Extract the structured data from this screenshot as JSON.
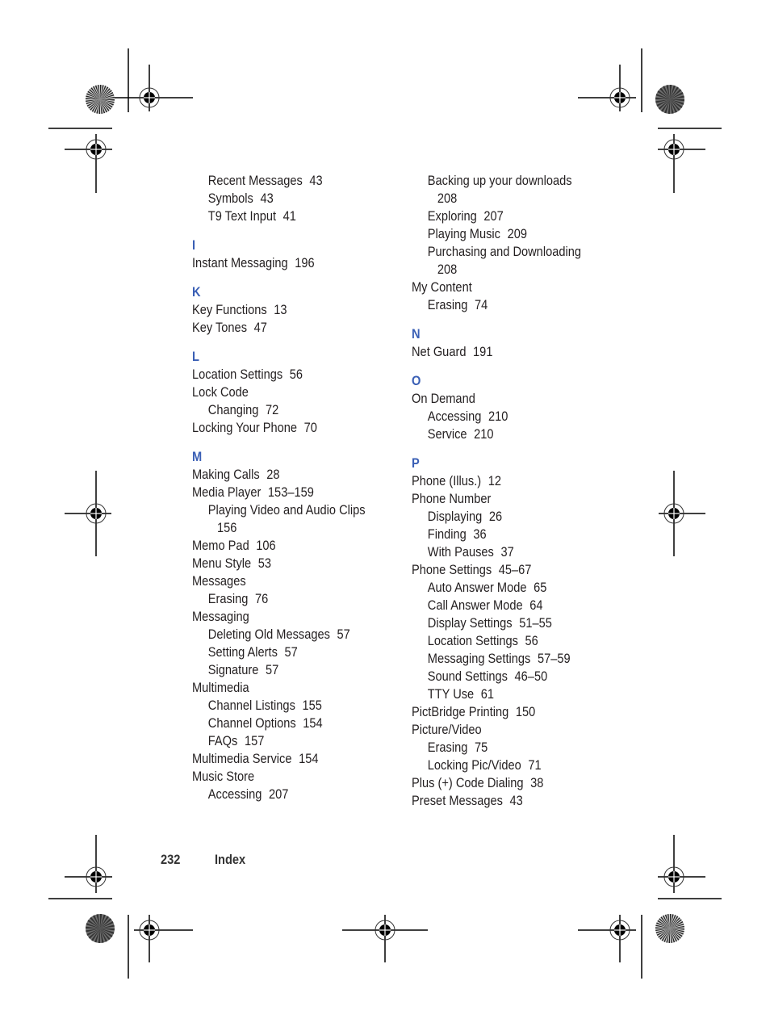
{
  "left_column": [
    {
      "type": "sub",
      "text": "Recent Messages",
      "page": "43"
    },
    {
      "type": "sub",
      "text": "Symbols",
      "page": "43"
    },
    {
      "type": "sub",
      "text": "T9 Text Input",
      "page": "41"
    },
    {
      "type": "letter",
      "text": "I"
    },
    {
      "type": "main",
      "text": "Instant Messaging",
      "page": "196"
    },
    {
      "type": "letter",
      "text": "K"
    },
    {
      "type": "main",
      "text": "Key Functions",
      "page": "13"
    },
    {
      "type": "main",
      "text": "Key Tones",
      "page": "47"
    },
    {
      "type": "letter",
      "text": "L"
    },
    {
      "type": "main",
      "text": "Location Settings",
      "page": "56"
    },
    {
      "type": "main",
      "text": "Lock Code",
      "page": ""
    },
    {
      "type": "sub",
      "text": "Changing",
      "page": "72"
    },
    {
      "type": "main",
      "text": "Locking Your Phone",
      "page": "70"
    },
    {
      "type": "letter",
      "text": "M"
    },
    {
      "type": "main",
      "text": "Making Calls",
      "page": "28"
    },
    {
      "type": "main",
      "text": "Media Player",
      "page": "153–159"
    },
    {
      "type": "sub",
      "text": "Playing Video and Audio Clips",
      "page": ""
    },
    {
      "type": "cont",
      "text": "",
      "page": "156"
    },
    {
      "type": "main",
      "text": "Memo Pad",
      "page": "106"
    },
    {
      "type": "main",
      "text": "Menu Style",
      "page": "53"
    },
    {
      "type": "main",
      "text": "Messages",
      "page": ""
    },
    {
      "type": "sub",
      "text": "Erasing",
      "page": "76"
    },
    {
      "type": "main",
      "text": "Messaging",
      "page": ""
    },
    {
      "type": "sub",
      "text": "Deleting Old Messages",
      "page": "57"
    },
    {
      "type": "sub",
      "text": "Setting Alerts",
      "page": "57"
    },
    {
      "type": "sub",
      "text": "Signature",
      "page": "57"
    },
    {
      "type": "main",
      "text": "Multimedia",
      "page": ""
    },
    {
      "type": "sub",
      "text": "Channel Listings",
      "page": "155"
    },
    {
      "type": "sub",
      "text": "Channel Options",
      "page": "154"
    },
    {
      "type": "sub",
      "text": "FAQs",
      "page": "157"
    },
    {
      "type": "main",
      "text": "Multimedia Service",
      "page": "154"
    },
    {
      "type": "main",
      "text": "Music Store",
      "page": ""
    },
    {
      "type": "sub",
      "text": "Accessing",
      "page": "207"
    }
  ],
  "right_column": [
    {
      "type": "sub",
      "text": "Backing up your downloads",
      "page": ""
    },
    {
      "type": "subcont",
      "text": "",
      "page": "208"
    },
    {
      "type": "sub",
      "text": "Exploring",
      "page": "207"
    },
    {
      "type": "sub",
      "text": "Playing Music",
      "page": "209"
    },
    {
      "type": "sub",
      "text": "Purchasing and Downloading",
      "page": ""
    },
    {
      "type": "subcont",
      "text": "",
      "page": "208"
    },
    {
      "type": "main",
      "text": "My Content",
      "page": ""
    },
    {
      "type": "sub",
      "text": "Erasing",
      "page": "74"
    },
    {
      "type": "letter",
      "text": "N"
    },
    {
      "type": "main",
      "text": "Net Guard",
      "page": "191"
    },
    {
      "type": "letter",
      "text": "O"
    },
    {
      "type": "main",
      "text": "On Demand",
      "page": ""
    },
    {
      "type": "sub",
      "text": "Accessing",
      "page": "210"
    },
    {
      "type": "sub",
      "text": "Service",
      "page": "210"
    },
    {
      "type": "letter",
      "text": "P"
    },
    {
      "type": "main",
      "text": "Phone (Illus.)",
      "page": "12"
    },
    {
      "type": "main",
      "text": "Phone Number",
      "page": ""
    },
    {
      "type": "sub",
      "text": "Displaying",
      "page": "26"
    },
    {
      "type": "sub",
      "text": "Finding",
      "page": "36"
    },
    {
      "type": "sub",
      "text": "With Pauses",
      "page": "37"
    },
    {
      "type": "main",
      "text": "Phone Settings",
      "page": "45–67"
    },
    {
      "type": "sub",
      "text": "Auto Answer Mode",
      "page": "65"
    },
    {
      "type": "sub",
      "text": "Call Answer Mode",
      "page": "64"
    },
    {
      "type": "sub",
      "text": "Display Settings",
      "page": "51–55"
    },
    {
      "type": "sub",
      "text": "Location Settings",
      "page": "56"
    },
    {
      "type": "sub",
      "text": "Messaging Settings",
      "page": "57–59"
    },
    {
      "type": "sub",
      "text": "Sound Settings",
      "page": "46–50"
    },
    {
      "type": "sub",
      "text": "TTY Use",
      "page": "61"
    },
    {
      "type": "main",
      "text": "PictBridge Printing",
      "page": "150"
    },
    {
      "type": "main",
      "text": "Picture/Video",
      "page": ""
    },
    {
      "type": "sub",
      "text": "Erasing",
      "page": "75"
    },
    {
      "type": "sub",
      "text": "Locking Pic/Video",
      "page": "71"
    },
    {
      "type": "main",
      "text": "Plus (+) Code Dialing",
      "page": "38"
    },
    {
      "type": "main",
      "text": "Preset Messages",
      "page": "43"
    }
  ],
  "footer": {
    "page_number": "232",
    "section_title": "Index"
  },
  "colors": {
    "letter_heading": "#3a5fb5",
    "text": "#231f20"
  }
}
